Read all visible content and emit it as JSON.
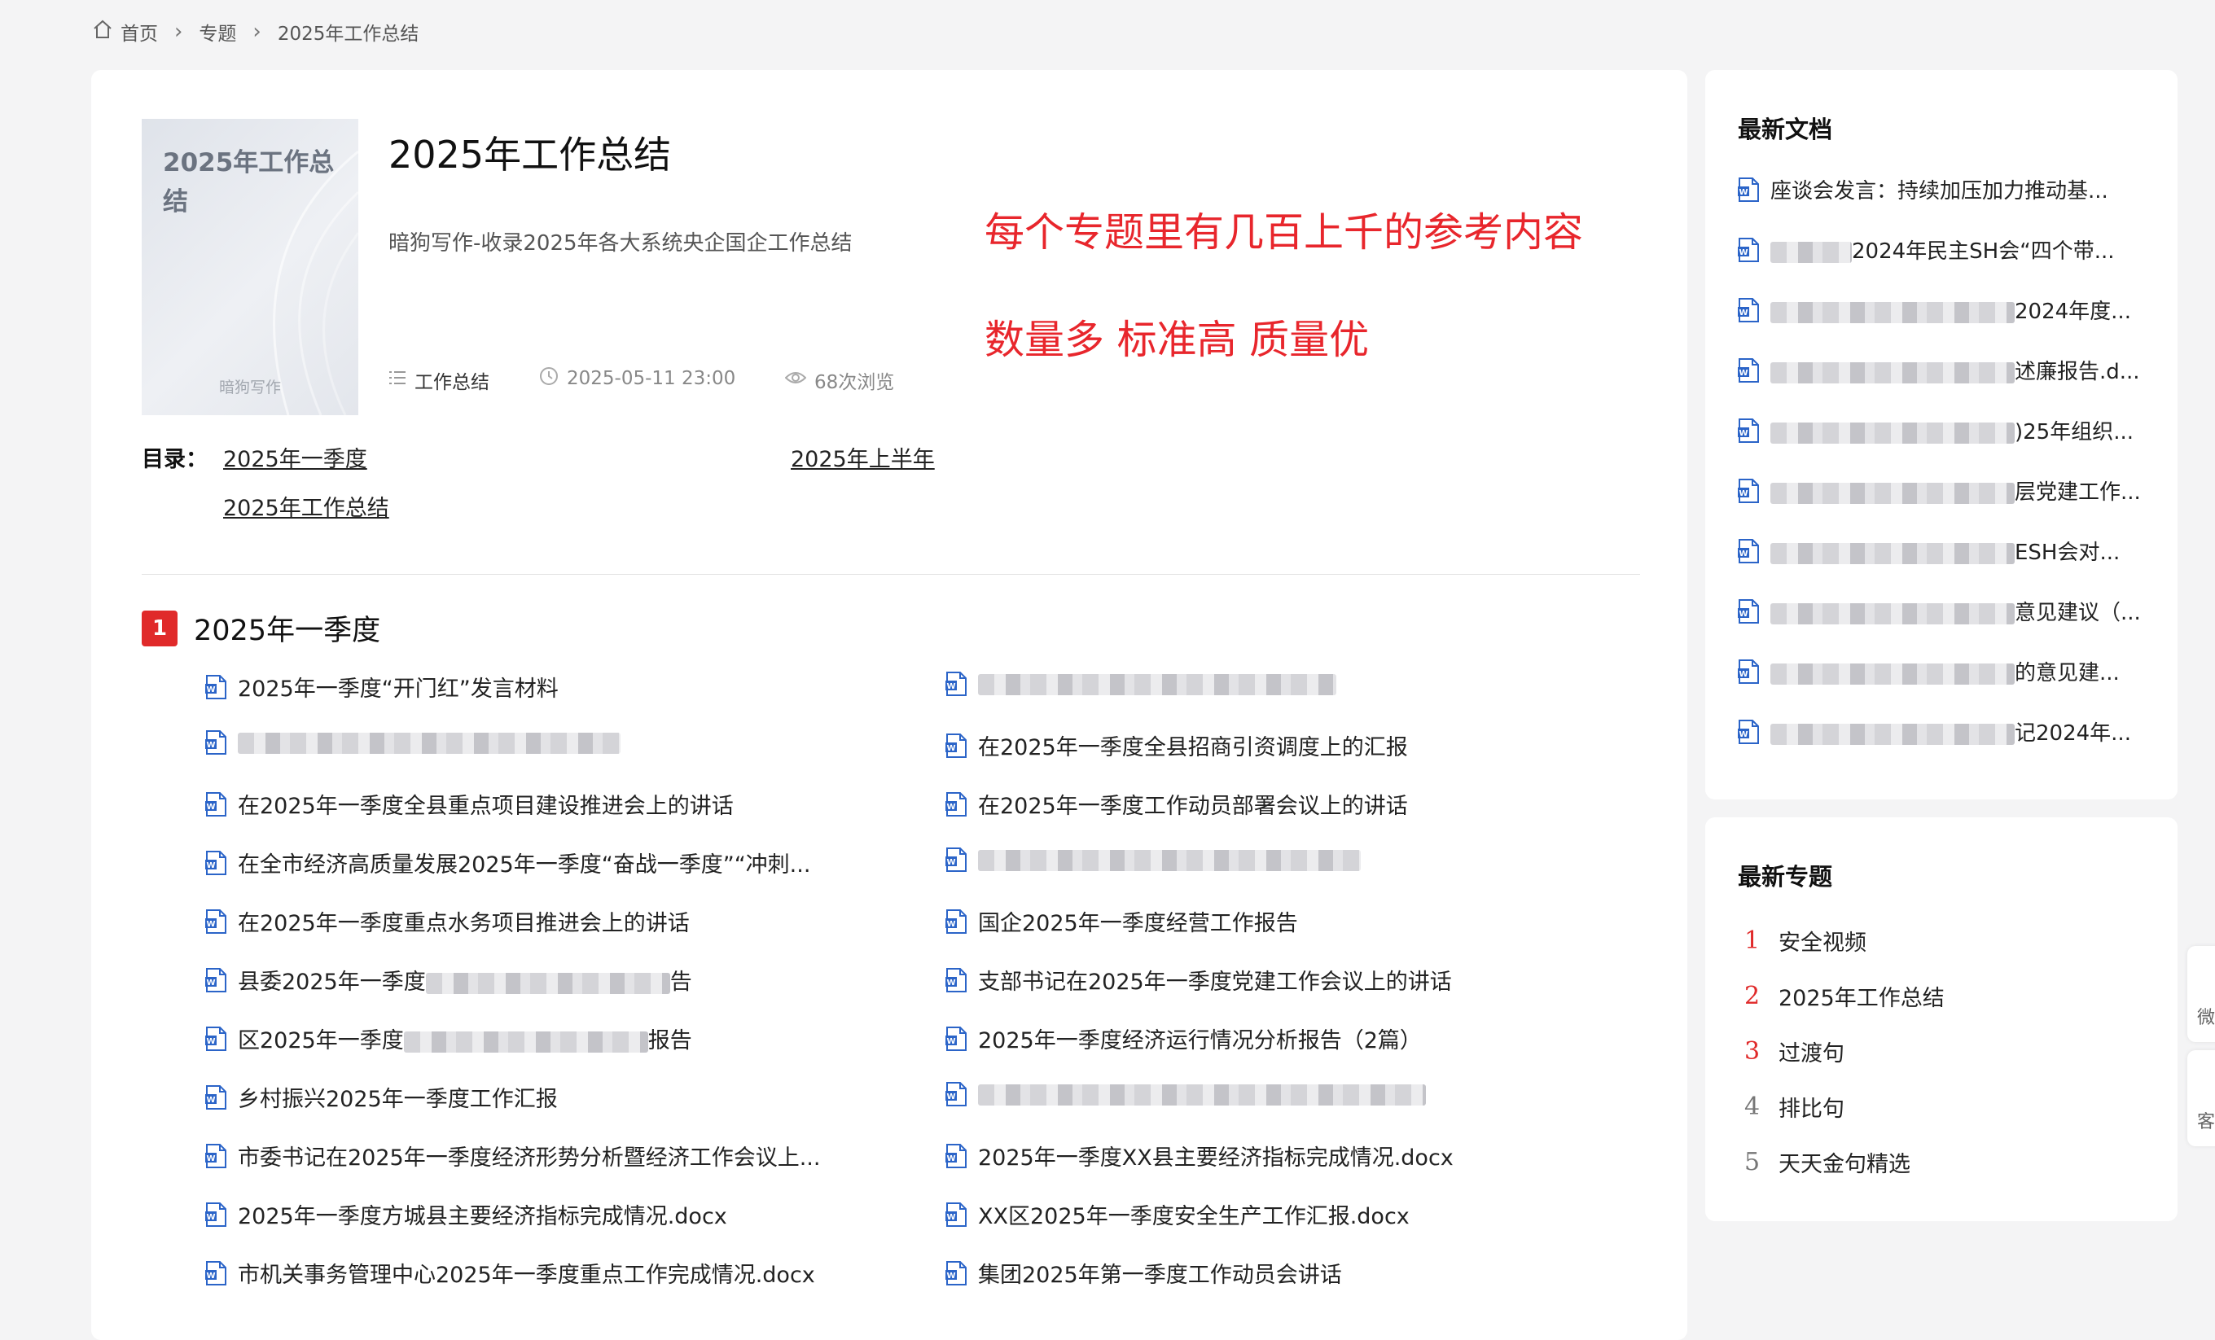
{
  "breadcrumb": {
    "home": "首页",
    "topic": "专题",
    "current": "2025年工作总结"
  },
  "cover": {
    "title": "2025年工作总结",
    "footer": "暗狗写作"
  },
  "topic": {
    "title": "2025年工作总结",
    "subtitle": "暗狗写作-收录2025年各大系统央企国企工作总结",
    "category": "工作总结",
    "date": "2025-05-11 23:00",
    "views": "68次浏览"
  },
  "promo": {
    "line1": "每个专题里有几百上千的参考内容",
    "line2": "数量多 标准高 质量优"
  },
  "toc": {
    "label": "目录：",
    "items": [
      "2025年一季度",
      "2025年上半年",
      "2025年工作总结"
    ]
  },
  "section": {
    "number": "1",
    "title": "2025年一季度",
    "left": [
      {
        "pre": "2025年一季度“开门红”发言材料",
        "post": ""
      },
      {
        "pre": "",
        "post": ""
      },
      {
        "pre": "在2025年一季度全县重点项目建设推进会上的讲话",
        "post": ""
      },
      {
        "pre": "在全市经济高质量发展2025年一季度“奋战一季度”“冲刺...",
        "post": ""
      },
      {
        "pre": "在2025年一季度重点水务项目推进会上的讲话",
        "post": ""
      },
      {
        "pre": "县委2025年一季度",
        "post": "告"
      },
      {
        "pre": "区2025年一季度",
        "post": "报告"
      },
      {
        "pre": "乡村振兴2025年一季度工作汇报",
        "post": ""
      },
      {
        "pre": "市委书记在2025年一季度经济形势分析暨经济工作会议上...",
        "post": ""
      },
      {
        "pre": "2025年一季度方城县主要经济指标完成情况.docx",
        "post": ""
      },
      {
        "pre": "市机关事务管理中心2025年一季度重点工作完成情况.docx",
        "post": ""
      }
    ],
    "right": [
      {
        "pre": "",
        "post": ""
      },
      {
        "pre": "在2025年一季度全县招商引资调度上的汇报",
        "post": ""
      },
      {
        "pre": "在2025年一季度工作动员部署会议上的讲话",
        "post": ""
      },
      {
        "pre": "",
        "post": ""
      },
      {
        "pre": "国企2025年一季度经营工作报告",
        "post": ""
      },
      {
        "pre": "支部书记在2025年一季度党建工作会议上的讲话",
        "post": ""
      },
      {
        "pre": "2025年一季度经济运行情况分析报告（2篇）",
        "post": ""
      },
      {
        "pre": "",
        "post": ""
      },
      {
        "pre": "2025年一季度XX县主要经济指标完成情况.docx",
        "post": ""
      },
      {
        "pre": "XX区2025年一季度安全生产工作汇报.docx",
        "post": ""
      },
      {
        "pre": "集团2025年第一季度工作动员会讲话",
        "post": ""
      }
    ]
  },
  "latest_docs": {
    "title": "最新文档",
    "items": [
      {
        "pre": "座谈会发言：持续加压加力推动基...",
        "post": ""
      },
      {
        "pre": "",
        "post": "2024年民主SH会“四个带..."
      },
      {
        "pre": "",
        "post": "2024年度..."
      },
      {
        "pre": "",
        "post": "述廉报告.d..."
      },
      {
        "pre": "",
        "post": ")25年组织..."
      },
      {
        "pre": "",
        "post": "层党建工作..."
      },
      {
        "pre": "",
        "post": "ESH会对..."
      },
      {
        "pre": "",
        "post": "意见建议（..."
      },
      {
        "pre": "",
        "post": "的意见建..."
      },
      {
        "pre": "",
        "post": "记2024年..."
      }
    ]
  },
  "latest_topics": {
    "title": "最新专题",
    "items": [
      {
        "n": "1",
        "label": "安全视频"
      },
      {
        "n": "2",
        "label": "2025年工作总结"
      },
      {
        "n": "3",
        "label": "过渡句"
      },
      {
        "n": "4",
        "label": "排比句"
      },
      {
        "n": "5",
        "label": "天天金句精选"
      }
    ]
  },
  "float": {
    "tab1": "微",
    "tab2": "客"
  },
  "colors": {
    "accent": "#e02a2a",
    "word_blue": "#2b64c8",
    "topic_red": "#e02a2a",
    "topic_gray": "#777777"
  }
}
